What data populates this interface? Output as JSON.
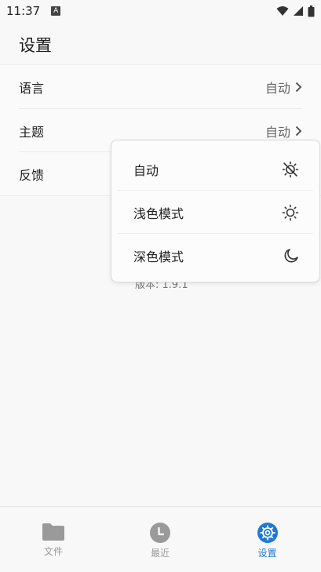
{
  "status_bar": {
    "time": "11:37",
    "badge": "A"
  },
  "page": {
    "title": "设置"
  },
  "settings": [
    {
      "label": "语言",
      "value": "自动"
    },
    {
      "label": "主题",
      "value": "自动"
    },
    {
      "label": "反馈"
    }
  ],
  "version_text": "版本: 1.9.1",
  "theme_menu": {
    "items": [
      {
        "label": "自动",
        "icon": "auto-brightness-icon"
      },
      {
        "label": "浅色模式",
        "icon": "sun-icon"
      },
      {
        "label": "深色模式",
        "icon": "moon-icon"
      }
    ]
  },
  "bottom_nav": {
    "active": "settings",
    "active_color": "#1e78d4",
    "items": [
      {
        "label": "文件",
        "icon": "folder-icon"
      },
      {
        "label": "最近",
        "icon": "clock-icon"
      },
      {
        "label": "设置",
        "icon": "gear-icon"
      }
    ]
  }
}
